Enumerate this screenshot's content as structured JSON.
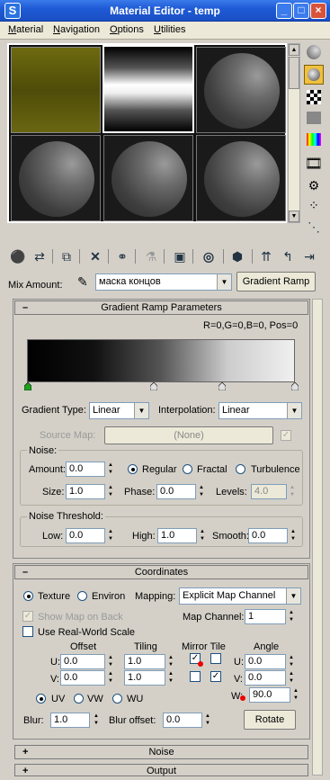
{
  "window": {
    "title": "Material Editor - temp",
    "app_icon": "3ds-max-icon",
    "controls": [
      "_",
      "□",
      "×"
    ]
  },
  "menu": [
    "Material",
    "Navigation",
    "Options",
    "Utilities"
  ],
  "mix": {
    "label": "Mix Amount:",
    "map_name": "маска концов",
    "map_type_button": "Gradient Ramp"
  },
  "gradient_ramp": {
    "header": "Gradient Ramp Parameters",
    "info": "R=0,G=0,B=0, Pos=0",
    "gradient_type_label": "Gradient Type:",
    "gradient_type": "Linear",
    "interpolation_label": "Interpolation:",
    "interpolation": "Linear",
    "source_map_label": "Source Map:",
    "source_map_value": "(None)",
    "noise": {
      "title": "Noise:",
      "amount_label": "Amount:",
      "amount": "0.0",
      "types": [
        "Regular",
        "Fractal",
        "Turbulence"
      ],
      "selected": "Regular",
      "size_label": "Size:",
      "size": "1.0",
      "phase_label": "Phase:",
      "phase": "0.0",
      "levels_label": "Levels:",
      "levels": "4.0"
    },
    "threshold": {
      "title": "Noise Threshold:",
      "low_label": "Low:",
      "low": "0.0",
      "high_label": "High:",
      "high": "1.0",
      "smooth_label": "Smooth:",
      "smooth": "0.0"
    }
  },
  "coordinates": {
    "header": "Coordinates",
    "texture": "Texture",
    "environ": "Environ",
    "mapping_label": "Mapping:",
    "mapping": "Explicit Map Channel",
    "show_map_on_back": "Show Map on Back",
    "map_channel_label": "Map Channel:",
    "map_channel": "1",
    "real_world": "Use Real-World Scale",
    "col_offset": "Offset",
    "col_tiling": "Tiling",
    "col_mirror_tile": "Mirror Tile",
    "col_angle": "Angle",
    "u_label": "U:",
    "v_label": "V:",
    "w_label": "W:",
    "u_offset": "0.0",
    "v_offset": "0.0",
    "u_tiling": "1.0",
    "v_tiling": "1.0",
    "u_angle": "0.0",
    "v_angle": "0.0",
    "w_angle": "90.0",
    "uv_options": [
      "UV",
      "VW",
      "WU"
    ],
    "blur_label": "Blur:",
    "blur": "1.0",
    "blur_offset_label": "Blur offset:",
    "blur_offset": "0.0",
    "rotate": "Rotate"
  },
  "rollouts": {
    "noise": "Noise",
    "output": "Output"
  },
  "colors": {
    "titlebar": "#1f5bd6",
    "highlight_slot": "#ffffff",
    "flag_active": "#1fa01f"
  }
}
